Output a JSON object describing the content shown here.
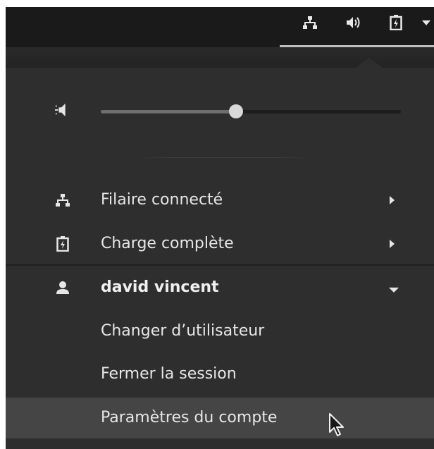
{
  "tray": {
    "icons": [
      "network-wired-icon",
      "speaker-volume-icon",
      "battery-charging-icon",
      "caret-down-icon"
    ]
  },
  "volume": {
    "icon": "speaker-muted-icon",
    "level": 0.45
  },
  "items": [
    {
      "label": "Filaire connecté",
      "icon": "network-wired-icon"
    },
    {
      "label": "Charge complète",
      "icon": "battery-charging-icon"
    }
  ],
  "user": {
    "name": "david vincent",
    "icon": "user-icon",
    "actions": [
      {
        "label": "Changer d’utilisateur"
      },
      {
        "label": "Fermer la session"
      },
      {
        "label": "Paramètres du compte"
      }
    ]
  },
  "colors": {
    "menu_bg": "#2e2e2e",
    "topbar_bg": "#1a1a1a",
    "hover_bg": "#454545",
    "text": "#e6e6e6"
  }
}
